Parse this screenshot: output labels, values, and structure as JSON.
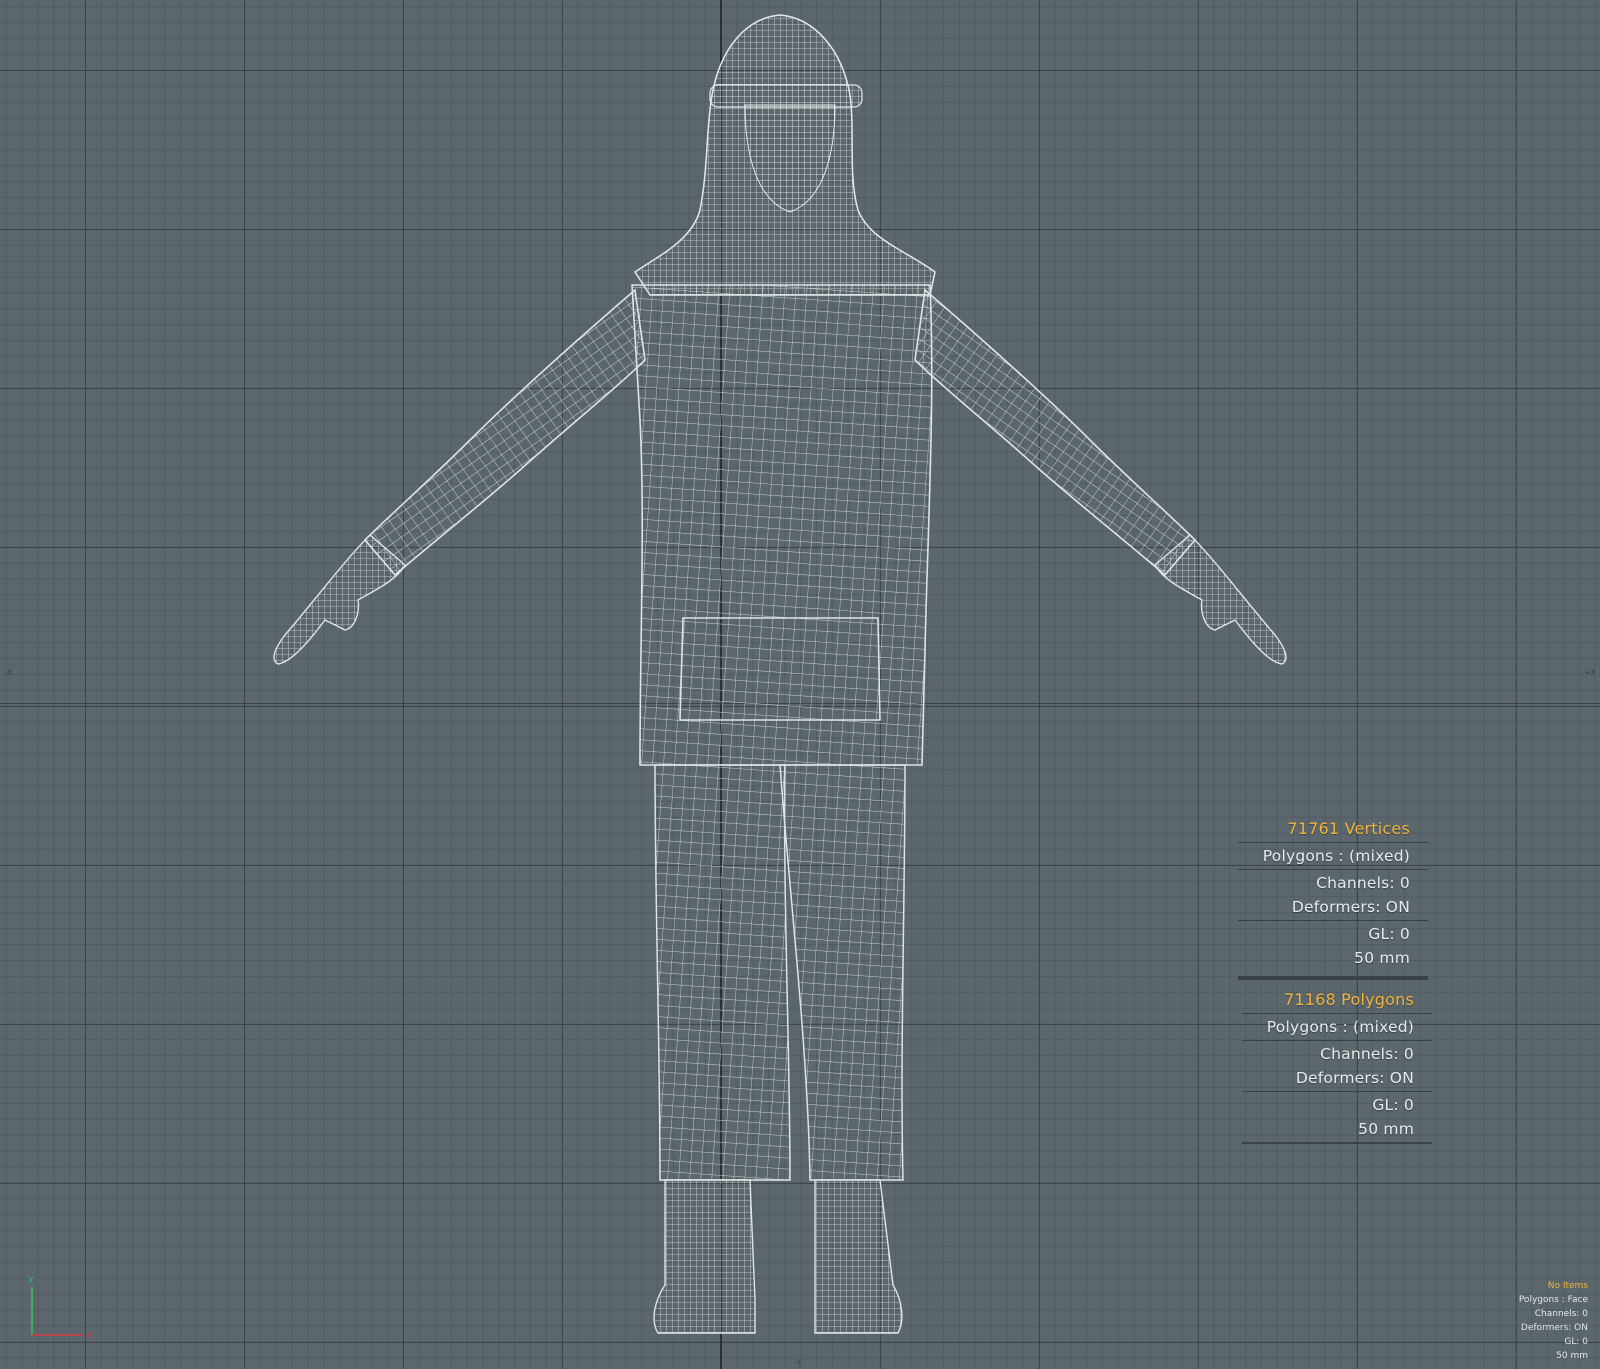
{
  "viewport": {
    "axis_labels": {
      "left": "-X",
      "right": "+X",
      "bottom": "-Y"
    },
    "gizmo": {
      "y_label": "Y",
      "x_label": "X",
      "y_color": "#40c060",
      "x_color": "#d04040"
    }
  },
  "vertices_panel": {
    "title": "71761 Vertices",
    "polygons": "Polygons : (mixed)",
    "channels": "Channels: 0",
    "deformers": "Deformers: ON",
    "gl": "GL: 0",
    "unit": "50 mm"
  },
  "polygons_panel": {
    "title": "71168 Polygons",
    "polygons": "Polygons : (mixed)",
    "channels": "Channels: 0",
    "deformers": "Deformers: ON",
    "gl": "GL: 0",
    "unit": "50 mm"
  },
  "status_info": {
    "title": "No Items",
    "polygons": "Polygons : Face",
    "channels": "Channels: 0",
    "deformers": "Deformers: ON",
    "gl": "GL: 0",
    "unit": "50 mm"
  },
  "colors": {
    "background": "#5b666d",
    "wire": "#dfe3e6",
    "accent": "#f0b43a"
  }
}
